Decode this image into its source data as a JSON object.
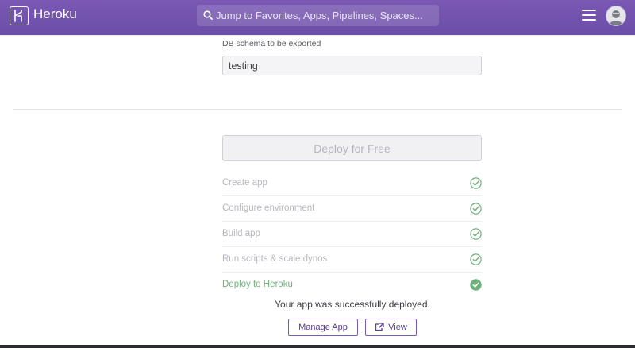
{
  "app": {
    "brand": "Heroku"
  },
  "search": {
    "placeholder": "Jump to Favorites, Apps, Pipelines, Spaces..."
  },
  "form": {
    "schema_label": "DB schema to be exported",
    "schema_value": "testing"
  },
  "deploy": {
    "button_label": "Deploy for Free",
    "steps": [
      {
        "label": "Create app",
        "status": "done"
      },
      {
        "label": "Configure environment",
        "status": "done"
      },
      {
        "label": "Build app",
        "status": "done"
      },
      {
        "label": "Run scripts & scale dynos",
        "status": "done"
      },
      {
        "label": "Deploy to Heroku",
        "status": "complete"
      }
    ],
    "success_message": "Your app was successfully deployed.",
    "manage_label": "Manage App",
    "view_label": "View"
  },
  "colors": {
    "header": "#6b4ea8",
    "success_green": "#6fb37b",
    "accent": "#7b5cb1"
  }
}
